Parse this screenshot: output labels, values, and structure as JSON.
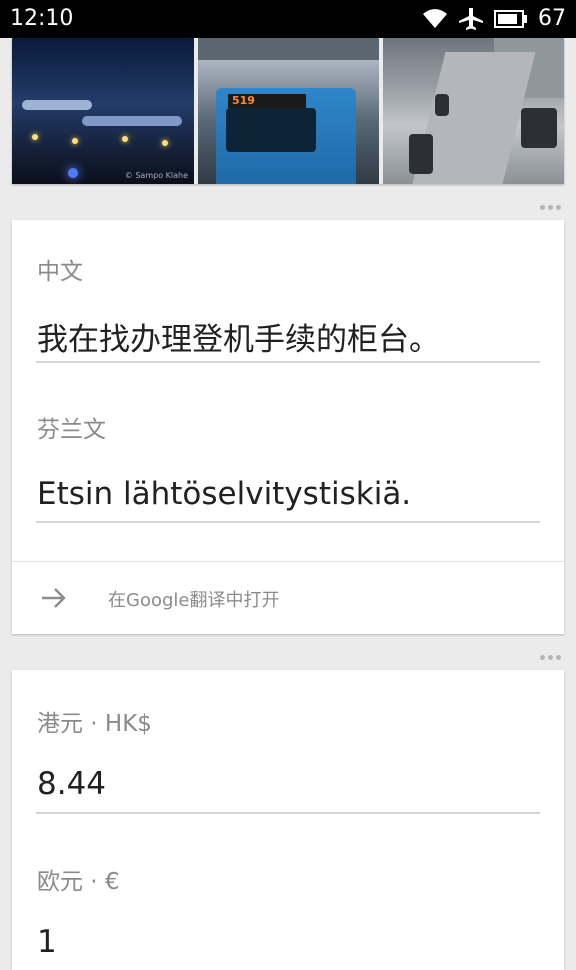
{
  "status_bar": {
    "time": "12:10",
    "battery": "67",
    "icons": [
      "wifi-icon",
      "airplane-icon",
      "battery-icon"
    ]
  },
  "images": {
    "credit": "© Sampo Klahe",
    "bus_display": "519"
  },
  "translation_card": {
    "source_label": "中文",
    "source_text": "我在找办理登机手续的柜台。",
    "target_label": "芬兰文",
    "target_text": "Etsin lähtöselvitystiskiä.",
    "open_label": "在Google翻译中打开"
  },
  "currency_card": {
    "from_label": "港元 · HK$",
    "from_value": "8.44",
    "to_label": "欧元 · €",
    "to_value": "1"
  },
  "colors": {
    "background": "#ebebeb",
    "card": "#ffffff",
    "label": "#8a8a8a",
    "value": "#212121"
  }
}
